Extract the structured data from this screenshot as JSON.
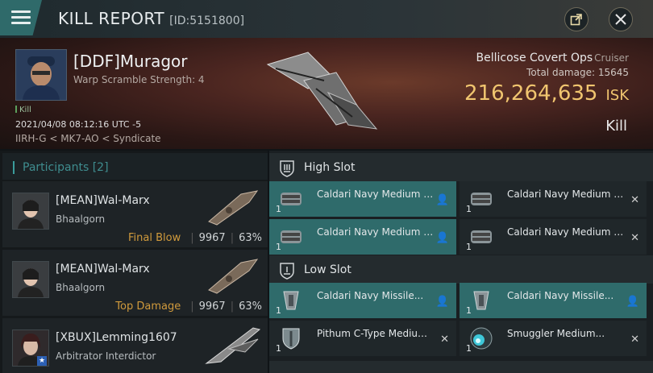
{
  "window": {
    "title": "KILL REPORT",
    "id_label": "[ID:5151800]"
  },
  "victim": {
    "name": "[DDF]Muragor",
    "warp_scramble": "Warp Scramble Strength: 4",
    "kill_tag": "Kill",
    "timestamp": "2021/04/08 08:12:16 UTC -5",
    "location": "IIRH-G < MK7-AO < Syndicate"
  },
  "ship": {
    "name": "Bellicose Covert Ops",
    "class": "Cruiser",
    "total_damage": "Total damage: 15645",
    "isk_value": "216,264,635",
    "isk_unit": "ISK",
    "result": "Kill"
  },
  "participants": {
    "header_label": "Participants",
    "count": "[2]",
    "rows": [
      {
        "name": "[MEAN]Wal-Marx",
        "ship": "Bhaalgorn",
        "role": "Final Blow",
        "damage": "9967",
        "percent": "63%"
      },
      {
        "name": "[MEAN]Wal-Marx",
        "ship": "Bhaalgorn",
        "role": "Top Damage",
        "damage": "9967",
        "percent": "63%"
      },
      {
        "name": "[XBUX]Lemming1607",
        "ship": "Arbitrator Interdictor"
      }
    ]
  },
  "fitting": {
    "high_slot_label": "High Slot",
    "low_slot_label": "Low Slot",
    "high_modules": [
      {
        "name": "Caldari Navy Medium Missil...",
        "qty": "1",
        "status": "destroyed"
      },
      {
        "name": "Caldari Navy Medium Missil...",
        "qty": "1",
        "status": "dropped"
      },
      {
        "name": "Caldari Navy Medium Missil...",
        "qty": "1",
        "status": "destroyed"
      },
      {
        "name": "Caldari Navy Medium Missil...",
        "qty": "1",
        "status": "dropped"
      }
    ],
    "low_modules": [
      {
        "name": "Caldari Navy Missile...",
        "qty": "1",
        "status": "destroyed"
      },
      {
        "name": "Caldari Navy Missile...",
        "qty": "1",
        "status": "destroyed"
      },
      {
        "name": "Pithum C-Type Medium...",
        "qty": "1",
        "status": "dropped"
      },
      {
        "name": "Smuggler Medium...",
        "qty": "1",
        "status": "dropped"
      }
    ]
  },
  "icons": {
    "menu": "hamburger-menu-icon",
    "share": "share-external-icon",
    "close": "close-icon",
    "high_slot": "high-slot-shield-icon",
    "low_slot": "low-slot-shield-icon",
    "destroyed_marker": "person-icon",
    "dropped_marker": "x-icon"
  },
  "colors": {
    "accent": "#2f6b6b",
    "isk": "#f0c56f",
    "final_blow": "#d09a3c"
  }
}
